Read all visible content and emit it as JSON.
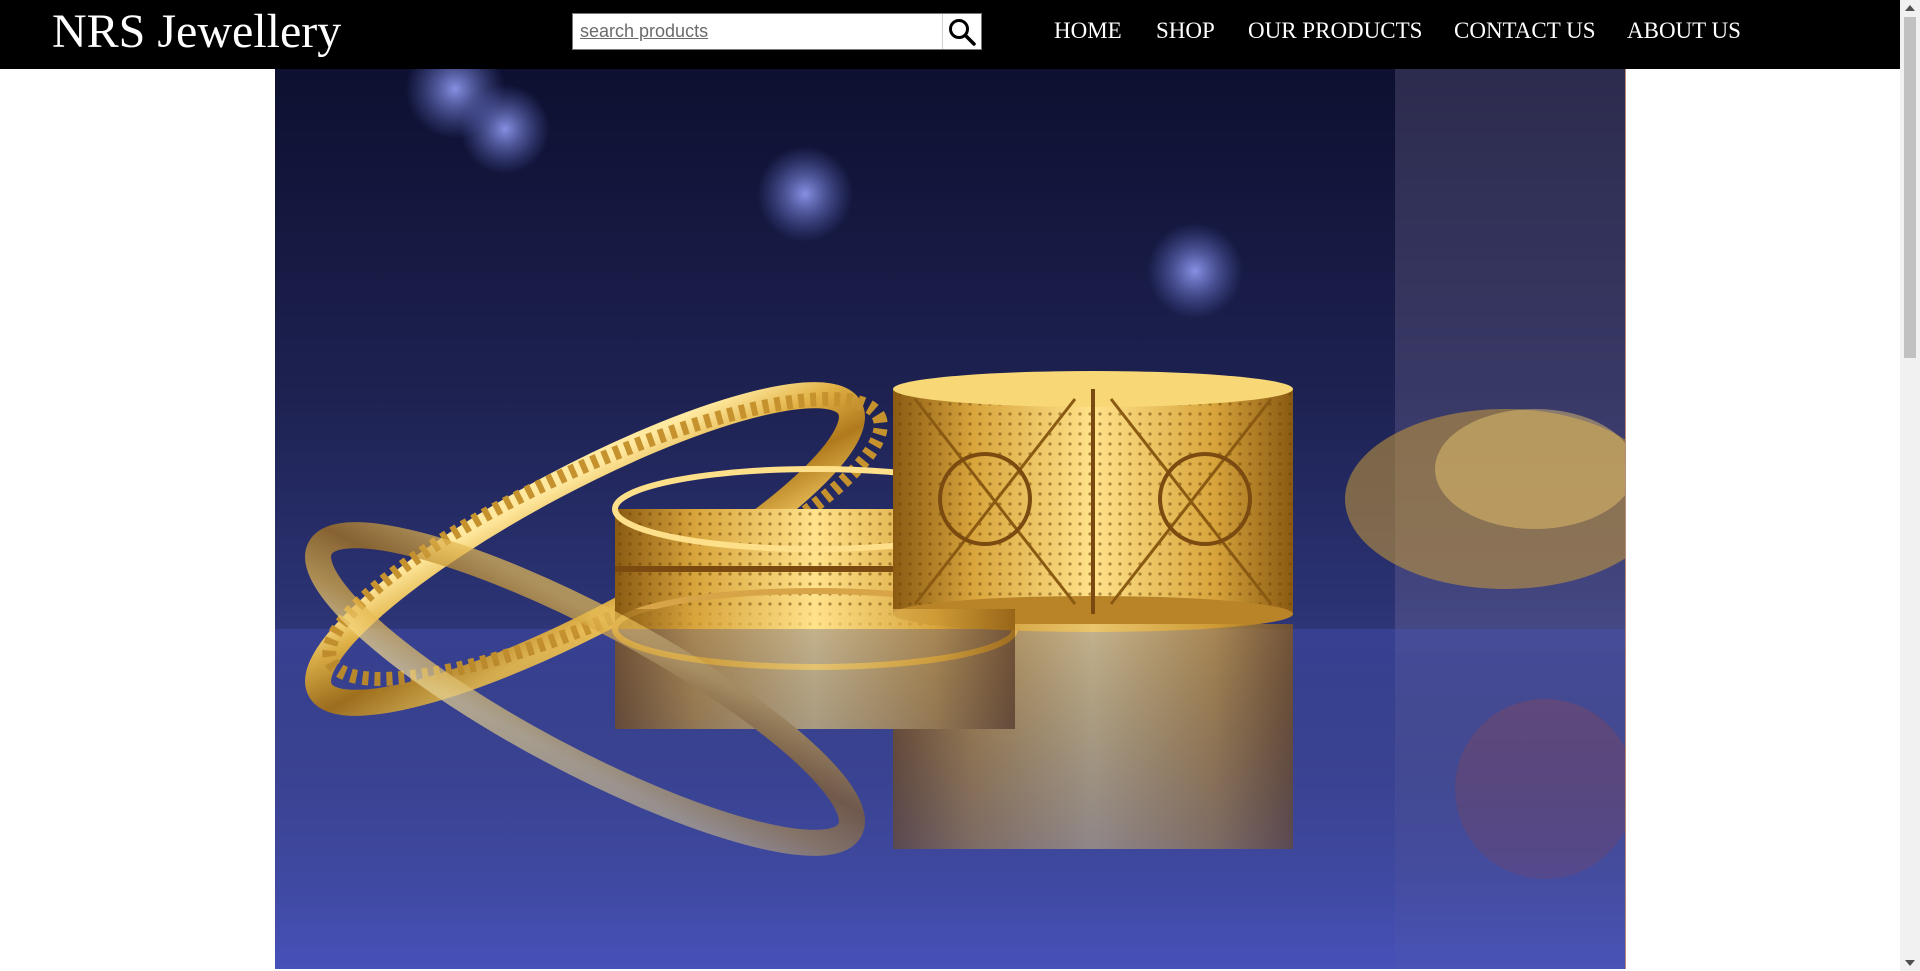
{
  "brand": {
    "name": "NRS Jewellery"
  },
  "search": {
    "placeholder": "search products",
    "icon": "search-icon"
  },
  "nav": {
    "items": [
      {
        "label": "HOME"
      },
      {
        "label": "SHOP"
      },
      {
        "label": "OUR PRODUCTS"
      },
      {
        "label": "CONTACT US"
      },
      {
        "label": "ABOUT US"
      }
    ]
  },
  "hero": {
    "image": "gold-bangles-photo",
    "colors": {
      "background": "#2a2f6e",
      "gold": "#c9962a",
      "highlight": "#ffe08a"
    }
  },
  "theme": {
    "header_bg": "#000000",
    "header_text": "#ffffff",
    "page_bg": "#ffffff"
  }
}
